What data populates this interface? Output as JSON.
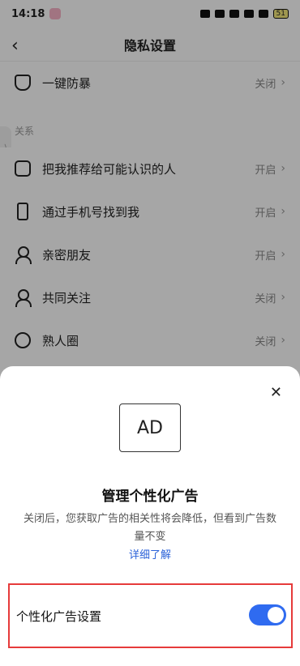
{
  "status_bar": {
    "time": "14:18",
    "battery": "51"
  },
  "header": {
    "back_glyph": "‹",
    "title": "隐私设置"
  },
  "top_item": {
    "label": "一键防暴",
    "value": "关闭"
  },
  "section": {
    "label": "关系",
    "handle_glyph": "⟩"
  },
  "items": [
    {
      "label": "把我推荐给可能认识的人",
      "value": "开启",
      "icon": "contact-card-icon"
    },
    {
      "label": "通过手机号找到我",
      "value": "开启",
      "icon": "phone-icon"
    },
    {
      "label": "亲密朋友",
      "value": "开启",
      "icon": "person-heart-icon"
    },
    {
      "label": "共同关注",
      "value": "关闭",
      "icon": "person-check-icon"
    },
    {
      "label": "熟人圈",
      "value": "关闭",
      "icon": "circle-icon"
    }
  ],
  "chevron": "›",
  "sheet": {
    "close_glyph": "✕",
    "ad_text": "AD",
    "title": "管理个性化广告",
    "desc": "关闭后，您获取广告的相关性将会降低，但看到广告数量不变",
    "link": "详细了解",
    "setting_label": "个性化广告设置",
    "toggle_on": true
  },
  "colors": {
    "accent": "#2f6bf0",
    "highlight": "#e63b3b"
  }
}
